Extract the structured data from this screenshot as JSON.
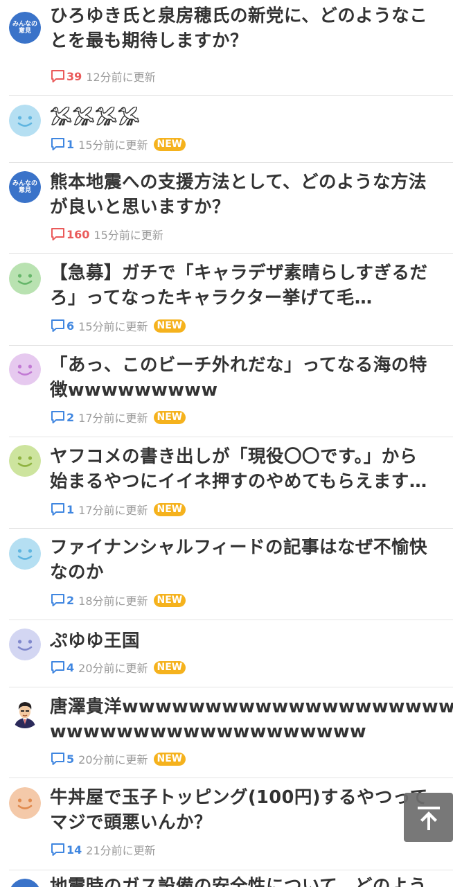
{
  "new_label": "NEW",
  "items": [
    {
      "title1": "ひろゆき氏と泉房穂氏の新党に、どのようなこ",
      "title2": "とを最も期待しますか？",
      "count": "39",
      "time": "12分前に更新",
      "hot": true,
      "is_new": false,
      "avatar": "minna",
      "avatar_text1": "みんなの",
      "avatar_text2": "意見"
    },
    {
      "title1": "𓅮𓅮𓅮𓅮",
      "title2": "",
      "count": "1",
      "time": "15分前に更新",
      "hot": false,
      "is_new": true,
      "avatar": "face",
      "color": "#b5dff2",
      "features": "#5fb5e0"
    },
    {
      "title1": "熊本地震への支援方法として、どのような方法",
      "title2": "が良いと思いますか？",
      "count": "160",
      "time": "15分前に更新",
      "hot": true,
      "is_new": false,
      "avatar": "minna",
      "avatar_text1": "みんなの",
      "avatar_text2": "意見"
    },
    {
      "title1": "【急募】ガチで「キャラデザ素晴らしすぎるだ",
      "title2": "ろ」ってなったキャラクター挙げて毛…",
      "count": "6",
      "time": "15分前に更新",
      "hot": false,
      "is_new": true,
      "avatar": "face",
      "color": "#b9e2b1",
      "features": "#66b66a"
    },
    {
      "title1": "「あっ、このビーチ外れだな」ってなる海の特",
      "title2": "徴wwwwwwwww",
      "count": "2",
      "time": "17分前に更新",
      "hot": false,
      "is_new": true,
      "avatar": "face",
      "color": "#e6c9ef",
      "features": "#c27ad4"
    },
    {
      "title1": "ヤフコメの書き出しが「現役〇〇です。」から",
      "title2": "始まるやつにイイネ押すのやめてもらえます…",
      "count": "1",
      "time": "17分前に更新",
      "hot": false,
      "is_new": true,
      "avatar": "face",
      "color": "#cde49e",
      "features": "#8fb340"
    },
    {
      "title1": "ファイナンシャルフィードの記事はなぜ不愉快",
      "title2": "なのか",
      "count": "2",
      "time": "18分前に更新",
      "hot": false,
      "is_new": true,
      "avatar": "face",
      "color": "#b5dff2",
      "features": "#5fb5e0"
    },
    {
      "title1": "ぷゆゆ王国",
      "title2": "",
      "count": "4",
      "time": "20分前に更新",
      "hot": false,
      "is_new": true,
      "avatar": "face",
      "color": "#d3d6f2",
      "features": "#8088cc"
    },
    {
      "title1": "唐澤貴洋wwwwwwwwwwwwwwwwwwww",
      "title2": "wwwwwwwwwwwwwwwwwww",
      "count": "5",
      "time": "20分前に更新",
      "hot": false,
      "is_new": true,
      "avatar": "person"
    },
    {
      "title1": "牛丼屋で玉子トッピング(100円)するやつって",
      "title2": "マジで頭悪いんか？",
      "count": "14",
      "time": "21分前に更新",
      "hot": false,
      "is_new": false,
      "avatar": "face",
      "color": "#f4c9a9",
      "features": "#e08a4e"
    },
    {
      "title1": "地震時のガス設備の安全性について、どのよう",
      "title2": "",
      "count": "",
      "time": "",
      "hot": false,
      "is_new": false,
      "avatar": "minna",
      "avatar_text1": "",
      "avatar_text2": ""
    }
  ],
  "colors": {
    "comment_blue": "#3f86e0",
    "comment_red": "#ea5a5a",
    "new_badge": "#f5b21d",
    "minna_avatar": "#3a73c9"
  },
  "scroll_top_icon": "arrow-up-to-top-icon"
}
